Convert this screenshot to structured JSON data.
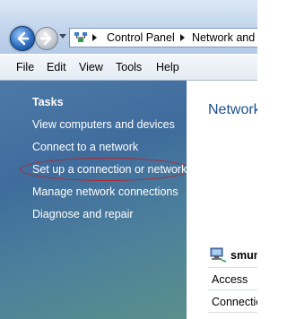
{
  "address_bar": {
    "back_icon": "back-arrow-icon",
    "forward_icon": "forward-arrow-icon",
    "crumbs": [
      "Control Panel",
      "Network and S"
    ]
  },
  "menu": {
    "items": [
      "File",
      "Edit",
      "View",
      "Tools",
      "Help"
    ]
  },
  "tasks": {
    "title": "Tasks",
    "links": [
      "View computers and devices",
      "Connect to a network",
      "Set up a connection or network",
      "Manage network connections",
      "Diagnose and repair"
    ],
    "highlight_color": "#b8262a"
  },
  "content": {
    "title": "Network",
    "network_name": "smun",
    "rows": [
      "Access",
      "Connection"
    ]
  },
  "colors": {
    "task_pane": "#4d79a8",
    "content_title": "#1d4f8c"
  }
}
